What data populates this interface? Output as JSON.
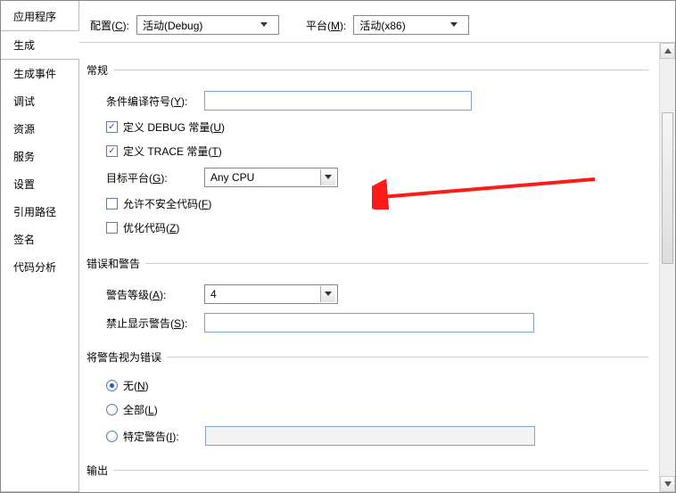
{
  "sidebar": {
    "items": [
      {
        "label": "应用程序"
      },
      {
        "label": "生成"
      },
      {
        "label": "生成事件"
      },
      {
        "label": "调试"
      },
      {
        "label": "资源"
      },
      {
        "label": "服务"
      },
      {
        "label": "设置"
      },
      {
        "label": "引用路径"
      },
      {
        "label": "签名"
      },
      {
        "label": "代码分析"
      }
    ],
    "active_index": 1
  },
  "toolbar": {
    "config_label_pre": "配置(",
    "config_label_key": "C",
    "config_label_post": "):",
    "config_value": "活动(Debug)",
    "platform_label_pre": "平台(",
    "platform_label_key": "M",
    "platform_label_post": "):",
    "platform_value": "活动(x86)"
  },
  "groups": {
    "general": "常规",
    "errors": "错误和警告",
    "treat": "将警告视为错误",
    "output": "输出"
  },
  "general": {
    "cond_label_pre": "条件编译符号(",
    "cond_label_key": "Y",
    "cond_label_post": "):",
    "cond_value": "",
    "def_debug_pre": "定义 DEBUG 常量(",
    "def_debug_key": "U",
    "def_debug_post": ")",
    "def_trace_pre": "定义 TRACE 常量(",
    "def_trace_key": "T",
    "def_trace_post": ")",
    "target_label_pre": "目标平台(",
    "target_label_key": "G",
    "target_label_post": "):",
    "target_value": "Any CPU",
    "unsafe_pre": "允许不安全代码(",
    "unsafe_key": "F",
    "unsafe_post": ")",
    "optimize_pre": "优化代码(",
    "optimize_key": "Z",
    "optimize_post": ")"
  },
  "errors": {
    "warn_level_pre": "警告等级(",
    "warn_level_key": "A",
    "warn_level_post": "):",
    "warn_level_value": "4",
    "suppress_pre": "禁止显示警告(",
    "suppress_key": "S",
    "suppress_post": "):",
    "suppress_value": ""
  },
  "treat": {
    "none_pre": "无(",
    "none_key": "N",
    "none_post": ")",
    "all_pre": "全部(",
    "all_key": "L",
    "all_post": ")",
    "specific_pre": "特定警告(",
    "specific_key": "I",
    "specific_post": "):",
    "specific_value": ""
  }
}
